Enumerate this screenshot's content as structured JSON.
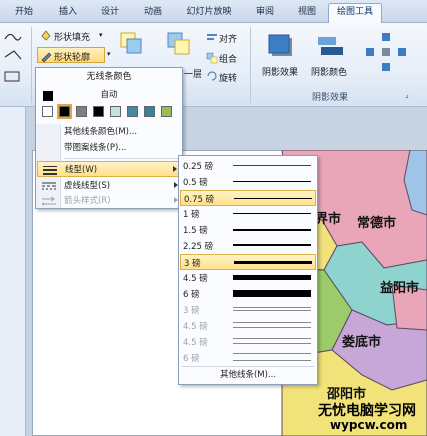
{
  "tabs": [
    "开始",
    "插入",
    "设计",
    "动画",
    "幻灯片放映",
    "审阅",
    "视图",
    "绘图工具"
  ],
  "ribbon": {
    "shape_fill": "形状填充",
    "shape_outline": "形状轮廓",
    "one_layer": "一层",
    "align": "对齐",
    "group": "组合",
    "rotate": "旋转",
    "shadow_effect_1": "阴影效果",
    "shadow_color": "阴影颜色",
    "shadow_group_label": "阴影效果"
  },
  "outline_menu": {
    "header": "无线条颜色",
    "auto": "自动",
    "swatch_colors": [
      "#ffffff",
      "#000000",
      "#7f7f7f",
      "#000000",
      "#c6e2e0",
      "#4a86a8",
      "#31859c",
      "#9bbb59"
    ],
    "more_colors": "其他线条颜色(M)...",
    "pattern_lines": "带图案线条(P)...",
    "weight": "线型(W)",
    "dashes": "虚线线型(S)",
    "arrows": "箭头样式(R)"
  },
  "weights_menu": {
    "items": [
      {
        "label": "0.25 磅",
        "weight": 0.25
      },
      {
        "label": "0.5 磅",
        "weight": 0.5
      },
      {
        "label": "0.75 磅",
        "weight": 0.75
      },
      {
        "label": "1 磅",
        "weight": 1
      },
      {
        "label": "1.5 磅",
        "weight": 1.5
      },
      {
        "label": "2.25 磅",
        "weight": 2.25
      },
      {
        "label": "3 磅",
        "weight": 3
      },
      {
        "label": "4.5 磅",
        "weight": 4.5
      },
      {
        "label": "6 磅",
        "weight": 6
      },
      {
        "label": "3 磅",
        "weight": 3
      },
      {
        "label": "4.5 磅",
        "weight": 4.5
      },
      {
        "label": "4.5 磅",
        "weight": 4.5
      },
      {
        "label": "6 磅",
        "weight": 6
      }
    ],
    "more": "其他线条(M)..."
  },
  "map": {
    "cities": [
      "常德市",
      "益阳市",
      "娄底市",
      "邵阳市"
    ],
    "partial_city": "界市"
  },
  "watermark": {
    "line1": "无忧电脑学习网",
    "line2": "wypcw.com"
  },
  "colors": {
    "accent_orange": "#e3a73b",
    "highlight": "#ffe08a",
    "map_pink": "#e8a6b8",
    "map_teal": "#8fd3cf",
    "map_yellow": "#f2e27a",
    "map_green": "#9ccc6a",
    "map_blue": "#9ec5e8",
    "map_purple": "#c6a7d8"
  }
}
